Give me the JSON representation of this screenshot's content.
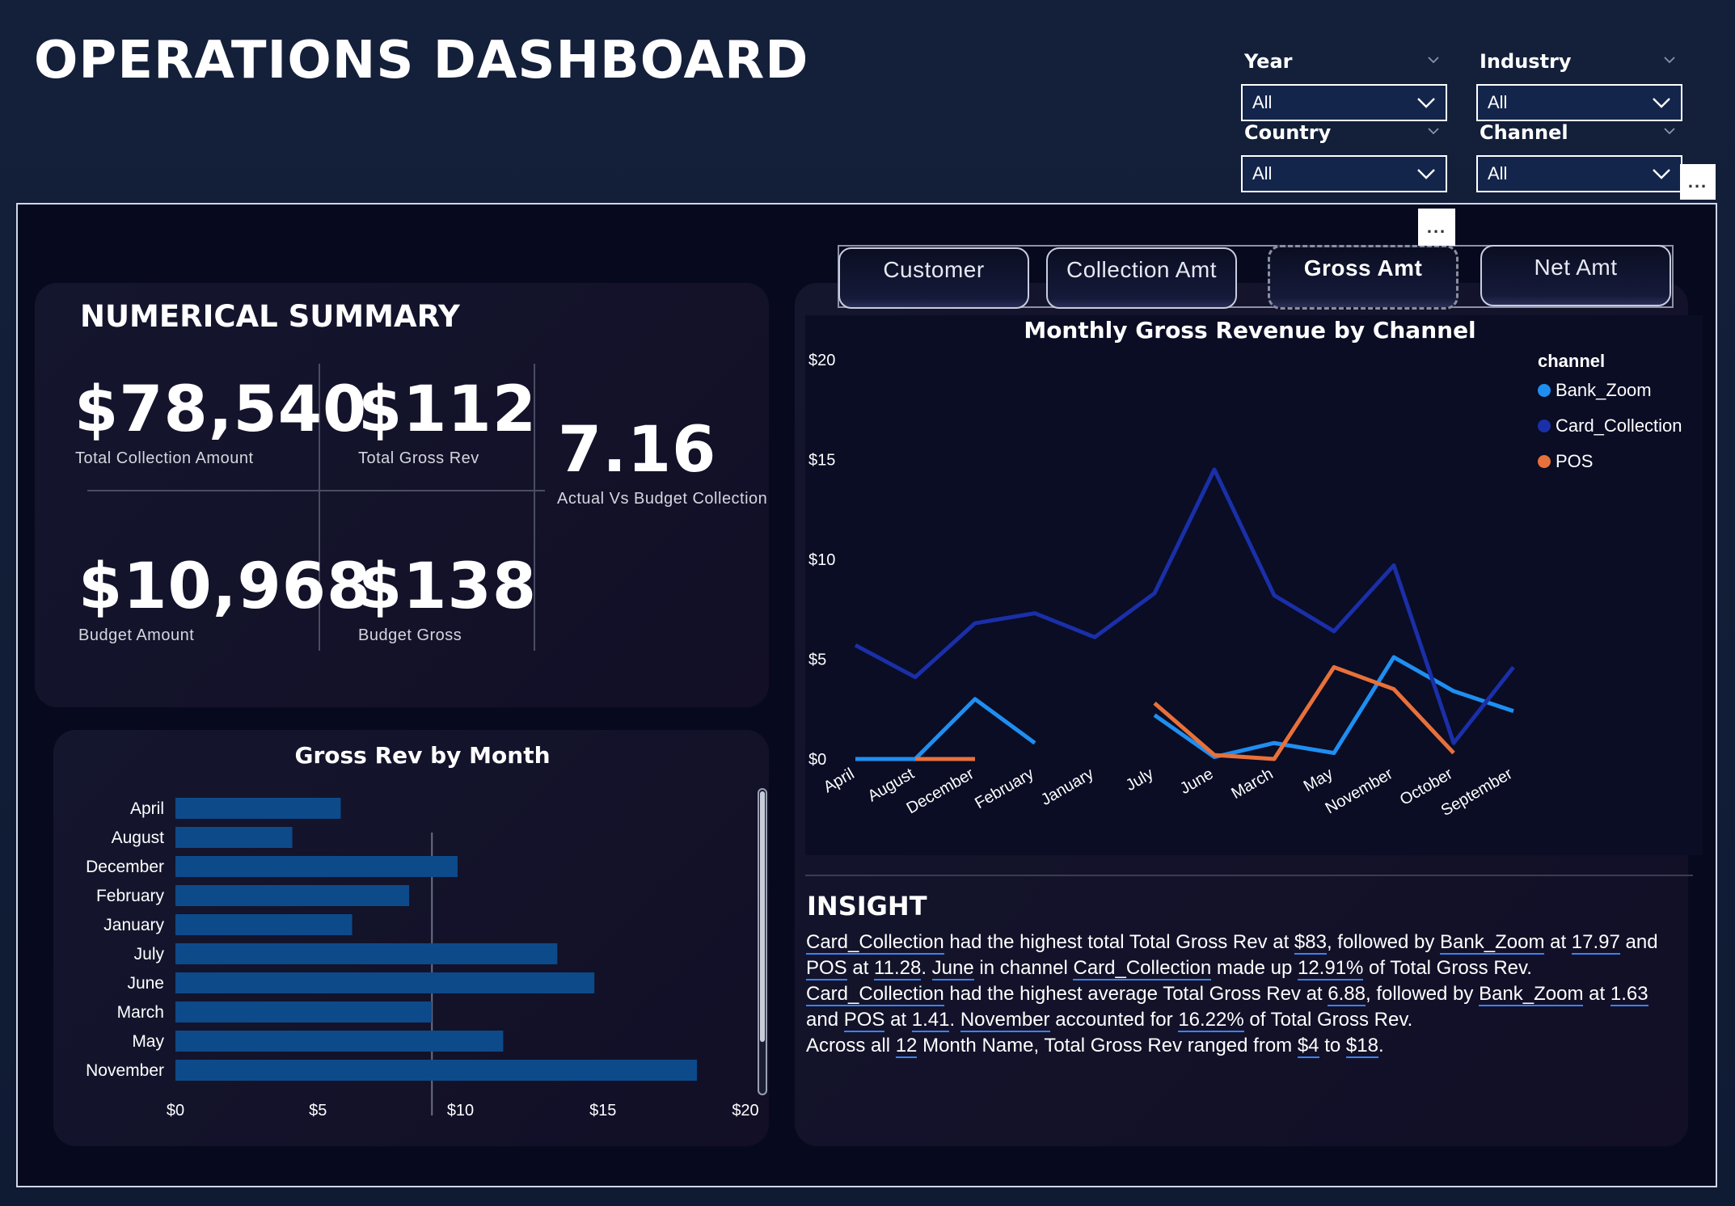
{
  "header": {
    "title": "OPERATIONS DASHBOARD"
  },
  "slicers": [
    {
      "label": "Year",
      "value": "All"
    },
    {
      "label": "Industry",
      "value": "All"
    },
    {
      "label": "Country",
      "value": "All"
    },
    {
      "label": "Channel",
      "value": "All"
    }
  ],
  "more_options": "...",
  "summary": {
    "title": "NUMERICAL SUMMARY",
    "kpis": [
      {
        "value": "$78,540",
        "label": "Total Collection Amount"
      },
      {
        "value": "$112",
        "label": "Total Gross Rev"
      },
      {
        "value": "7.16",
        "label": "Actual Vs Budget Collection"
      },
      {
        "value": "$10,968",
        "label": "Budget Amount"
      },
      {
        "value": "$138",
        "label": "Budget Gross"
      }
    ]
  },
  "tabs": [
    {
      "label": "Customer",
      "active": false
    },
    {
      "label": "Collection Amt",
      "active": false
    },
    {
      "label": "Gross Amt",
      "active": true
    },
    {
      "label": "Net Amt",
      "active": false
    }
  ],
  "colors": {
    "bank_zoom": "#1f8ef1",
    "card_collection": "#1a2fa8",
    "pos": "#e8703a",
    "bar": "#0d4a8a"
  },
  "chart_data": [
    {
      "type": "bar",
      "title": "Gross Rev by Month",
      "orientation": "horizontal",
      "categories": [
        "April",
        "August",
        "December",
        "February",
        "January",
        "July",
        "June",
        "March",
        "May",
        "November"
      ],
      "values": [
        5.8,
        4.1,
        9.9,
        8.2,
        6.2,
        13.4,
        14.7,
        9.0,
        11.5,
        18.3
      ],
      "xlim": [
        0,
        20
      ],
      "xticks": [
        "$0",
        "$5",
        "$10",
        "$15",
        "$20"
      ],
      "reference_line": 9.0
    },
    {
      "type": "line",
      "title": "Monthly Gross Revenue by Channel",
      "legend_title": "channel",
      "legend_position": "top-right",
      "categories": [
        "April",
        "August",
        "December",
        "February",
        "January",
        "July",
        "June",
        "March",
        "May",
        "November",
        "October",
        "September"
      ],
      "yticks": [
        "$0",
        "$5",
        "$10",
        "$15",
        "$20"
      ],
      "ylim": [
        0,
        20
      ],
      "series": [
        {
          "name": "Bank_Zoom",
          "values": [
            0,
            0,
            3.0,
            0.8,
            null,
            2.2,
            0.1,
            0.8,
            0.3,
            5.1,
            3.4,
            2.4
          ]
        },
        {
          "name": "Card_Collection",
          "values": [
            5.7,
            4.1,
            6.8,
            7.3,
            6.1,
            8.3,
            14.5,
            8.2,
            6.4,
            9.7,
            0.8,
            4.6
          ]
        },
        {
          "name": "POS",
          "values": [
            null,
            0,
            0,
            null,
            null,
            2.8,
            0.2,
            0,
            4.6,
            3.5,
            0.3,
            null
          ]
        }
      ]
    }
  ],
  "insight": {
    "title": "INSIGHT",
    "line1": [
      "Card_Collection",
      " had the highest total Total Gross Rev at ",
      "$83",
      ", followed by ",
      "Bank_Zoom",
      " at ",
      "17.97",
      " and"
    ],
    "line2": [
      "POS",
      " at ",
      "11.28",
      ". ",
      "June",
      " in channel ",
      "Card_Collection",
      " made up ",
      "12.91%",
      " of Total Gross Rev."
    ],
    "line3": [
      "Card_Collection",
      " had the highest average Total Gross Rev at ",
      "6.88",
      ", followed by ",
      "Bank_Zoom",
      " at ",
      "1.63"
    ],
    "line4": [
      "and ",
      "POS",
      " at ",
      "1.41",
      ". ",
      "November",
      " accounted for ",
      "16.22%",
      " of Total Gross Rev."
    ],
    "line5": [
      "Across all ",
      "12",
      " Month Name, Total Gross Rev ranged from ",
      "$4",
      " to ",
      "$18",
      "."
    ]
  }
}
